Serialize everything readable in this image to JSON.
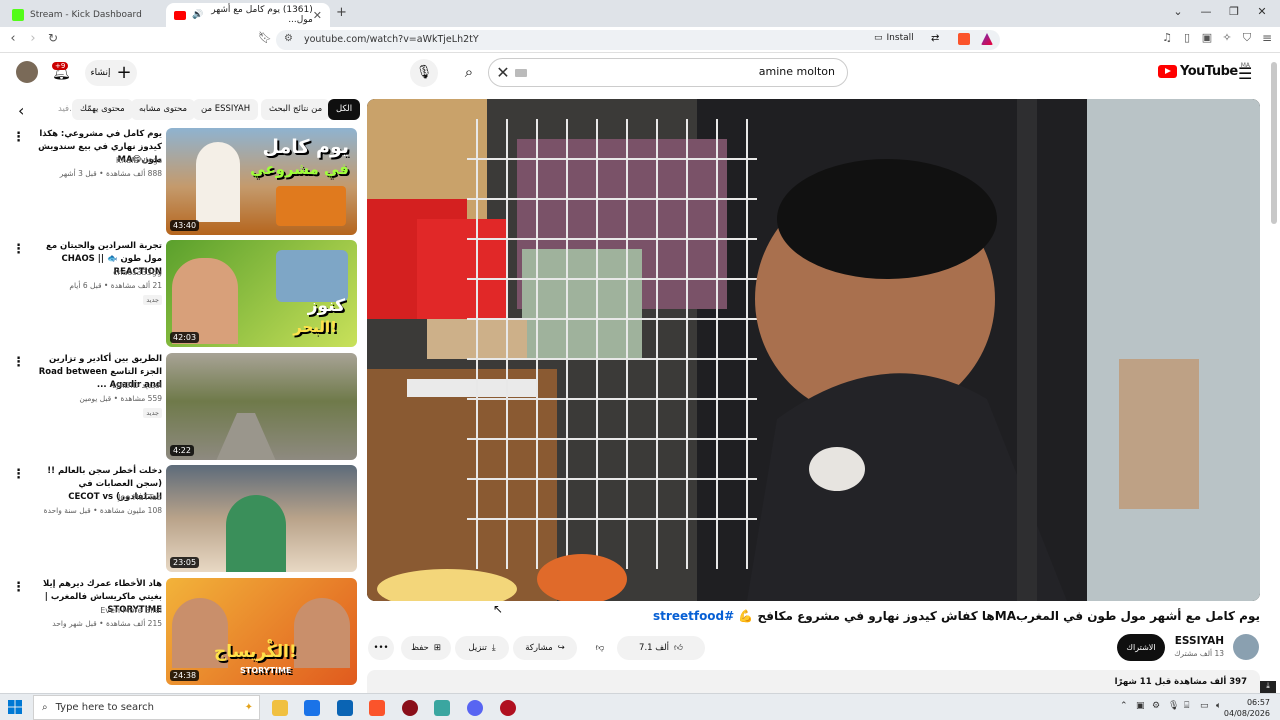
{
  "browser": {
    "tabs": [
      {
        "title": "Stream - Kick Dashboard",
        "active": false
      },
      {
        "title": "(1361) يوم كامل مع أشهر مول...",
        "active": true
      }
    ],
    "new_tab": "+",
    "url": "youtube.com/watch?v=aWkTjeLh2tY",
    "install_label": "Install",
    "window_controls": [
      "⌄",
      "—",
      "❐",
      "✕"
    ]
  },
  "youtube": {
    "logo_text": "YouTube",
    "logo_country": "MA",
    "search_value": "amine molton",
    "create_label": "إنشاء",
    "notification_count": "+9"
  },
  "chips": [
    "الكل",
    "من نتائج البحث",
    "من ESSIYAH",
    "محتوى مشابه",
    "محتوى يهمّك",
    "فيد..."
  ],
  "recommendations": [
    {
      "title": "يوم كامل في مشروعي: هكذا كيدوز نهاري في بيع سندويش طون😋MA",
      "channel": "Khalfi vlogs",
      "meta": "888 ألف مشاهدة • قبل 3 أشهر",
      "duration": "43:40",
      "thumb_text": [
        "يوم كامل",
        "في مشروعي"
      ],
      "badge": ""
    },
    {
      "title": "تجربة السرادين والحيتان مع مول طون 🐟 || CHAOS REACTION",
      "channel": "chaos333gg",
      "meta": "21 ألف مشاهدة • قبل 6 أيام",
      "duration": "42:03",
      "thumb_text": [
        "كنوز",
        "البحر!"
      ],
      "badge": "جديد"
    },
    {
      "title": "الطريق بين أكادير و تزارين الجزء التاسع Road between Agadir and ...",
      "channel": "LJADID الجديد",
      "meta": "559 مشاهدة • قبل يومين",
      "duration": "4:22",
      "thumb_text": [],
      "badge": "جديد"
    },
    {
      "title": "دخلت أخطر سجن بالعالم !! (سجن العصابات في السلفادور) CECOT vs",
      "channel": "Joe HaTTab",
      "meta": "108 مليون مشاهدة • قبل سنة واحدة",
      "duration": "23:05",
      "thumb_text": [],
      "badge": ""
    },
    {
      "title": "هاد الأخطاء عمرك ديرهم إيلا بغيتي ماكريساش فالمغرب | STORYTIME",
      "channel": "Even More Bilal",
      "meta": "215 ألف مشاهدة • قبل شهر واحد",
      "duration": "24:38",
      "thumb_text": [
        "الكْريساج!",
        "STORYTIME"
      ],
      "badge": ""
    }
  ],
  "video": {
    "title": "يوم كامل مع أشهر مول طون في المغربMAها كفاش كيدوز نهارو في مشروع مكافح 💪",
    "hashtag": "#streetfood",
    "channel": "ESSIYAH",
    "subscribers": "13 ألف مشترك",
    "subscribe_label": "الاشتراك",
    "likes": "7.1 ألف",
    "share_label": "مشاركة",
    "download_label": "تنزيل",
    "save_label": "حفظ",
    "more_label": "•••",
    "views": "397 ألف مشاهدة قبل 11 شهرًا"
  },
  "taskbar": {
    "search_placeholder": "Type here to search",
    "time": "06:57",
    "date": "04/08/2026"
  }
}
